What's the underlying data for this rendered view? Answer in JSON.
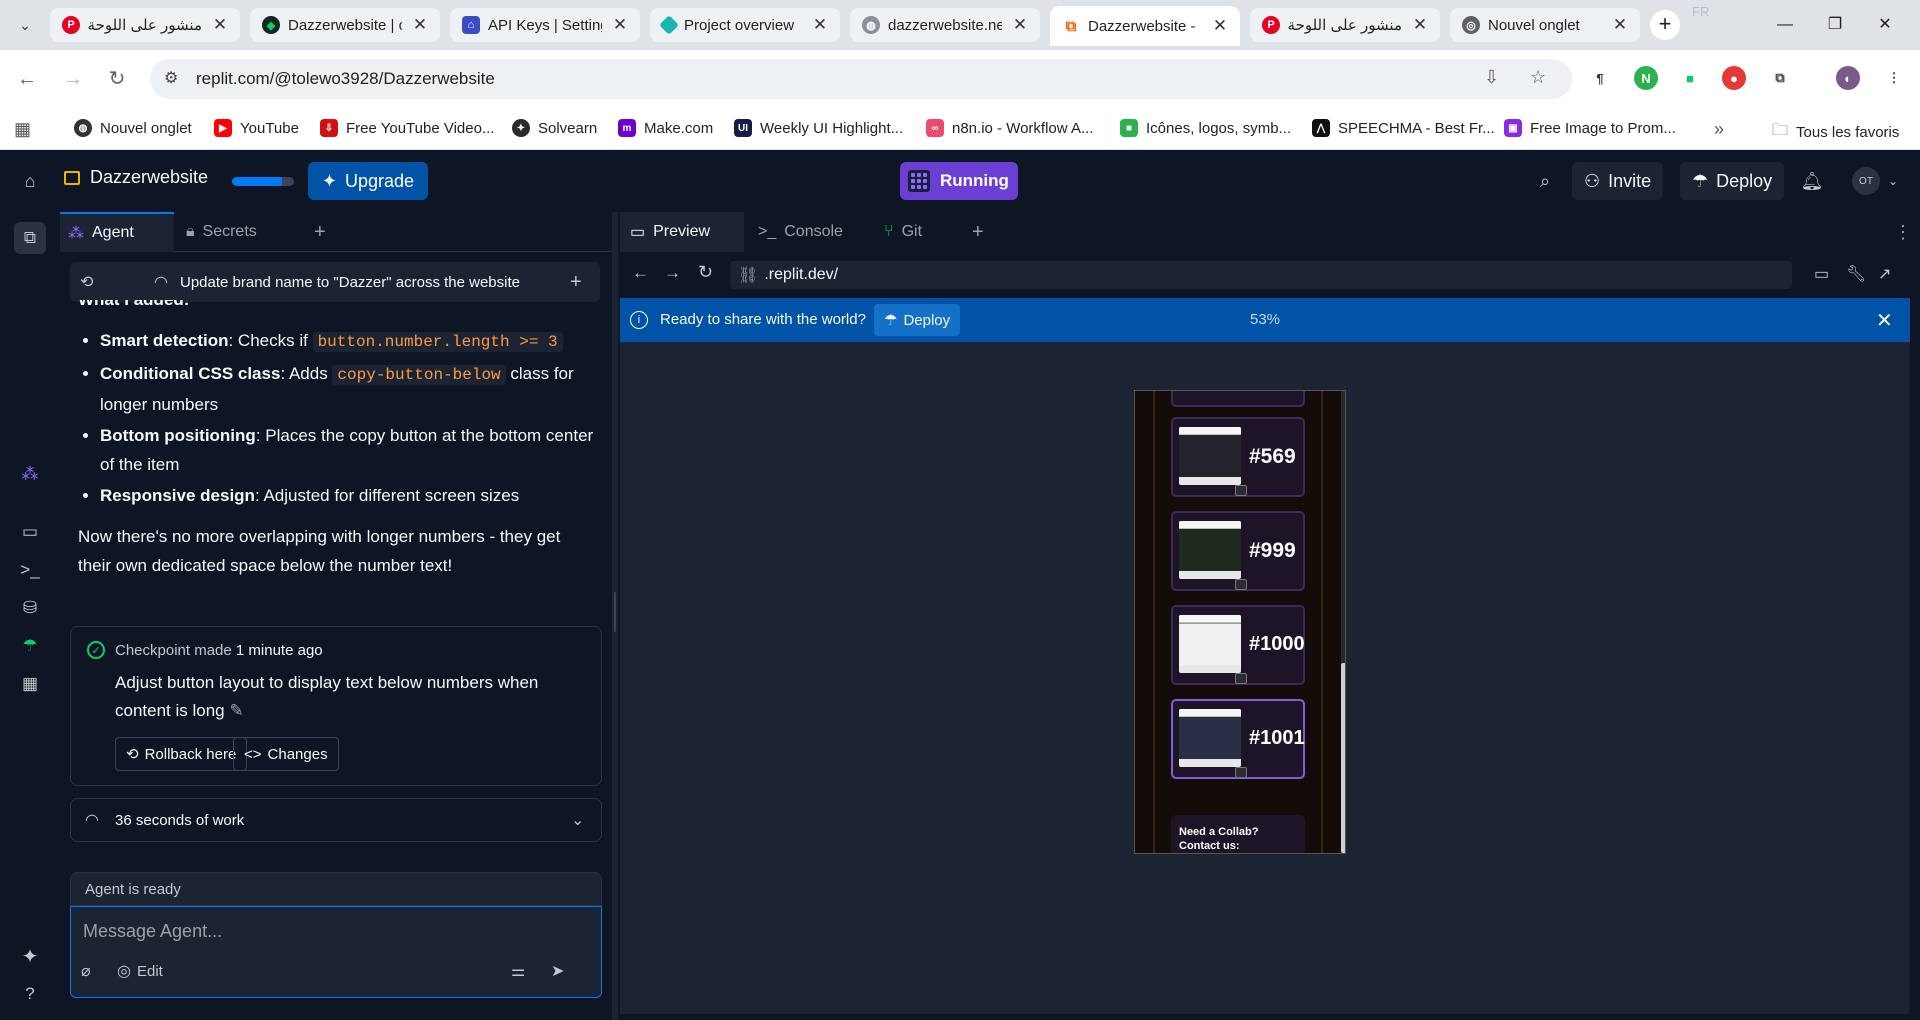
{
  "browser": {
    "tabs": [
      {
        "title": "منشور على اللوحة",
        "icon": "pinterest-icon",
        "color": "#e60023",
        "active": false
      },
      {
        "title": "Dazzerwebsite | c",
        "icon": "replit-icon",
        "color": "#0cce6b",
        "active": false
      },
      {
        "title": "API Keys | Setting",
        "icon": "keys-icon",
        "color": "#3b4cc0",
        "active": false
      },
      {
        "title": "Project overview",
        "icon": "diamond-icon",
        "color": "#1ab5b0",
        "active": false
      },
      {
        "title": "dazzerwebsite.ne",
        "icon": "globe-icon",
        "color": "#8a8f98",
        "active": false
      },
      {
        "title": "Dazzerwebsite -",
        "icon": "replit-icon",
        "color": "#f26207",
        "active": true
      },
      {
        "title": "منشور على اللوحة",
        "icon": "pinterest-icon",
        "color": "#e60023",
        "active": false
      },
      {
        "title": "Nouvel onglet",
        "icon": "chrome-icon",
        "color": "#5f6368",
        "active": false
      }
    ],
    "lang_badge": "FR",
    "url": "replit.com/@tolewo3928/Dazzerwebsite",
    "bookmarks": [
      {
        "label": "Nouvel onglet",
        "color": "#333333"
      },
      {
        "label": "YouTube",
        "color": "#ff0000"
      },
      {
        "label": "Free YouTube Video...",
        "color": "#d01010"
      },
      {
        "label": "Solvearn",
        "color": "#2a2a2a"
      },
      {
        "label": "Make.com",
        "color": "#6d00cc"
      },
      {
        "label": "Weekly UI Highlight...",
        "color": "#1a1a4a"
      },
      {
        "label": "n8n.io - Workflow A...",
        "color": "#ea4b71"
      },
      {
        "label": "Icônes, logos, symb...",
        "color": "#2bb24c"
      },
      {
        "label": "SPEECHMA - Best Fr...",
        "color": "#111111"
      },
      {
        "label": "Free Image to Prom...",
        "color": "#8a2be2"
      }
    ],
    "all_bookmarks": "Tous les favoris"
  },
  "app": {
    "project_name": "Dazzerwebsite",
    "plan_progress": 0.8,
    "upgrade_label": "Upgrade",
    "running_label": "Running",
    "invite_label": "Invite",
    "deploy_label": "Deploy",
    "avatar_initials": "OT",
    "accent": "#0079f2"
  },
  "agent": {
    "tabs": [
      "Agent",
      "Secrets"
    ],
    "thread_title": "Update brand name to \"Dazzer\" across the website",
    "partial_heading": "What I added:",
    "bullets": [
      {
        "bold": "Smart detection",
        "text": ": Checks if ",
        "code": "button.number.length >= 3",
        "after": ""
      },
      {
        "bold": "Conditional CSS class",
        "text": ": Adds ",
        "code": "copy-button-below",
        "after": " class for longer numbers"
      },
      {
        "bold": "Bottom positioning",
        "text": ": Places the copy button at the bottom center of the item",
        "code": "",
        "after": ""
      },
      {
        "bold": "Responsive design",
        "text": ": Adjusted for different screen sizes",
        "code": "",
        "after": ""
      }
    ],
    "summary": "Now there's no more overlapping with longer numbers - they get their own dedicated space below the number text!",
    "checkpoint": {
      "label": "Checkpoint made",
      "time": "1 minute ago",
      "description": "Adjust button layout to display text below numbers when content is long",
      "rollback_label": "Rollback here",
      "changes_label": "Changes"
    },
    "work_label": "36 seconds of work",
    "status": "Agent is ready",
    "input_placeholder": "Message Agent...",
    "edit_label": "Edit"
  },
  "preview": {
    "tabs": [
      "Preview",
      "Console",
      "Git"
    ],
    "url": ".replit.dev/",
    "banner_text": "Ready to share with the world?",
    "banner_deploy": "Deploy",
    "zoom": "53%",
    "cards": [
      "#569",
      "#999",
      "#1000",
      "#1001"
    ],
    "collab_text": "Need a Collab? Contact us:"
  }
}
